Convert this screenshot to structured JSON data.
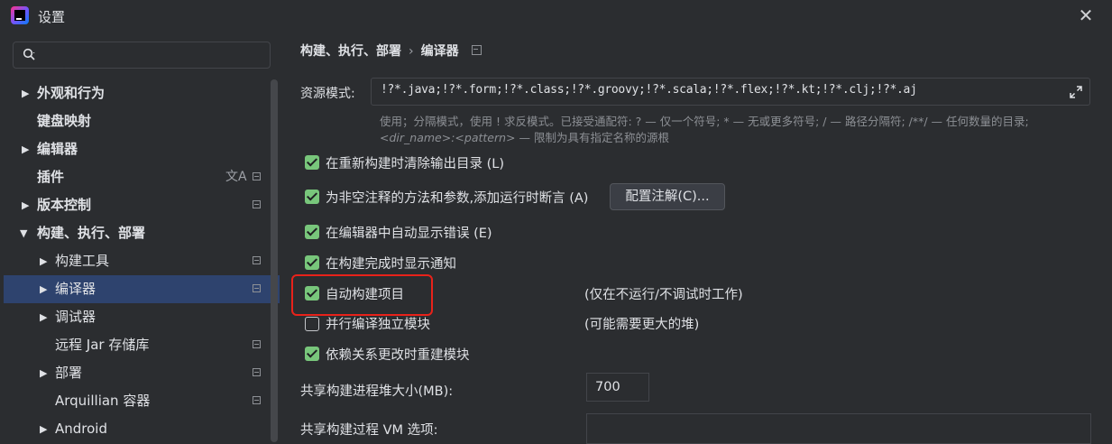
{
  "window": {
    "title": "设置",
    "close_glyph": "✕"
  },
  "sidebar": {
    "search": {
      "value": "",
      "placeholder": ""
    },
    "items": [
      {
        "label": "外观和行为",
        "arrow": "▶",
        "bold": true
      },
      {
        "label": "键盘映射",
        "arrow": "",
        "bold": true
      },
      {
        "label": "编辑器",
        "arrow": "▶",
        "bold": true
      },
      {
        "label": "插件",
        "arrow": "",
        "bold": true,
        "translate_glyph": "文A"
      },
      {
        "label": "版本控制",
        "arrow": "▶",
        "bold": true
      },
      {
        "label": "构建、执行、部署",
        "arrow": "▼",
        "bold": true
      },
      {
        "label": "构建工具",
        "arrow": "▶"
      },
      {
        "label": "编译器",
        "arrow": "▶",
        "selected": true
      },
      {
        "label": "调试器",
        "arrow": "▶"
      },
      {
        "label": "远程 Jar 存储库",
        "arrow": ""
      },
      {
        "label": "部署",
        "arrow": "▶"
      },
      {
        "label": "Arquillian 容器",
        "arrow": ""
      },
      {
        "label": "Android",
        "arrow": "▶"
      }
    ]
  },
  "breadcrumb": {
    "parent": "构建、执行、部署",
    "separator": "›",
    "current": "编译器"
  },
  "resource_patterns": {
    "label": "资源模式:",
    "value": "!?*.java;!?*.form;!?*.class;!?*.groovy;!?*.scala;!?*.flex;!?*.kt;!?*.clj;!?*.aj",
    "hint_line1": "使用；分隔模式，使用 ! 求反模式。已接受通配符: ? — 仅一个符号; * — 无或更多符号; / — 路径分隔符; /**/ — 任何数量的目录;",
    "hint_line2_pattern": "<dir_name>:<pattern>",
    "hint_line2_rest": " — 限制为具有指定名称的源根"
  },
  "options": [
    {
      "label": "在重新构建时清除输出目录 (L)",
      "checked": true
    },
    {
      "label": "为非空注释的方法和参数,添加运行时断言 (A)",
      "checked": true
    },
    {
      "label": "在编辑器中自动显示错误 (E)",
      "checked": true
    },
    {
      "label": "在构建完成时显示通知",
      "checked": true
    },
    {
      "label": "自动构建项目",
      "checked": true
    },
    {
      "label": "并行编译独立模块",
      "checked": false
    },
    {
      "label": "依赖关系更改时重建模块",
      "checked": true
    }
  ],
  "notes": {
    "auto_build": "(仅在不运行/不调试时工作)",
    "parallel": "(可能需要更大的堆)"
  },
  "configure_annotations_button": "配置注解(C)...",
  "heap": {
    "label": "共享构建进程堆大小(MB):",
    "value": "700"
  },
  "vm_options": {
    "label": "共享构建过程 VM 选项:",
    "value": ""
  },
  "colors": {
    "accent_selected": "#2e436e",
    "checkbox_on": "#78c67b",
    "highlight_box": "#e8221a"
  }
}
